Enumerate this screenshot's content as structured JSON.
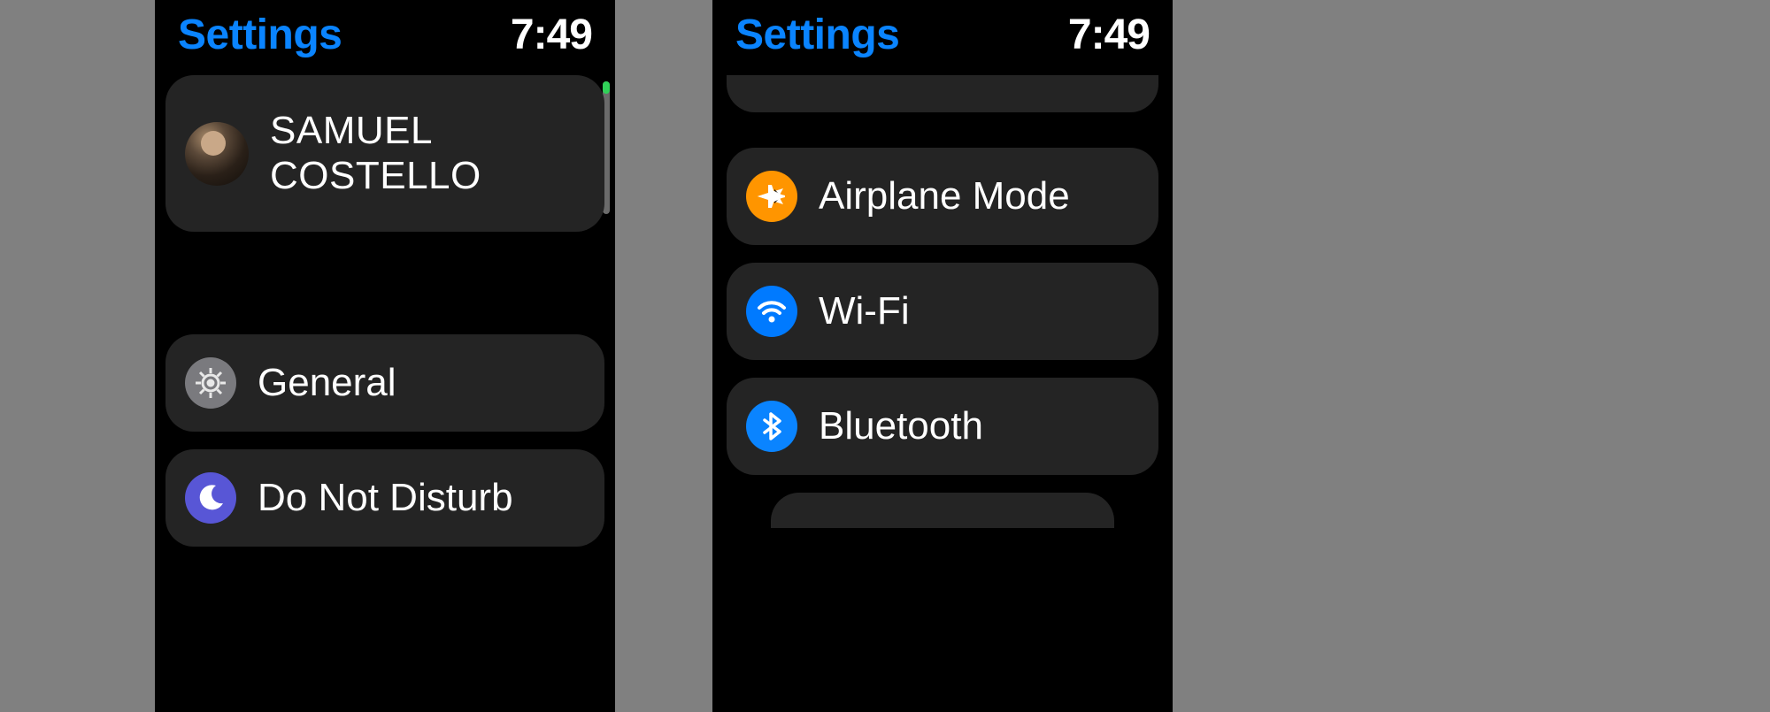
{
  "screen1": {
    "header": {
      "title": "Settings",
      "time": "7:49"
    },
    "profile": {
      "name_line1": "SAMUEL",
      "name_line2": "COSTELLO"
    },
    "items": [
      {
        "icon": "gear-icon",
        "label": "General"
      },
      {
        "icon": "moon-icon",
        "label": "Do Not Disturb"
      }
    ]
  },
  "screen2": {
    "header": {
      "title": "Settings",
      "time": "7:49"
    },
    "items": [
      {
        "icon": "airplane-icon",
        "label": "Airplane Mode"
      },
      {
        "icon": "wifi-icon",
        "label": "Wi-Fi"
      },
      {
        "icon": "bluetooth-icon",
        "label": "Bluetooth"
      }
    ]
  },
  "colors": {
    "accent": "#0a84ff",
    "card": "#242424",
    "orange": "#ff9500",
    "blue": "#007aff",
    "indigo": "#5856d6",
    "gray": "#7a7a7e",
    "green": "#30d158"
  }
}
